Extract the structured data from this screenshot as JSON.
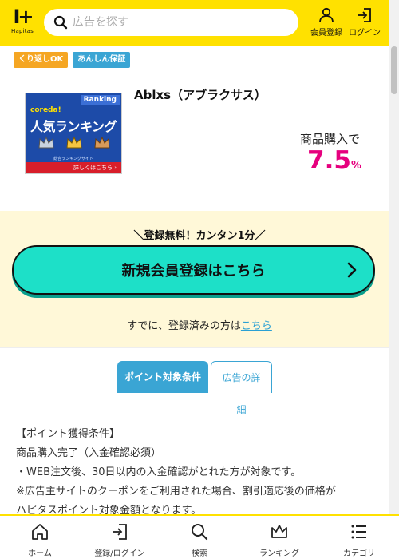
{
  "header": {
    "logo_text": "Hapitas",
    "search_placeholder": "広告を探す",
    "register_label": "会員登録",
    "login_label": "ログイン"
  },
  "tags": [
    "くり返しOK",
    "あんしん保証"
  ],
  "ad": {
    "name": "Ablxs（アブラクサス）",
    "banner": {
      "badge": "Ranking",
      "brand": "coreda!",
      "title": "人気ランキング",
      "sub": "総合ランキングサイト",
      "foot": "詳しくはこちら ›"
    },
    "reward_label": "商品購入で",
    "reward_value": "7.5",
    "reward_unit": "%"
  },
  "register": {
    "catch": "＼登録無料！カンタン1分／",
    "button_label": "新規会員登録はこちら",
    "login_prefix": "すでに、登録済みの方は",
    "login_link": "こちら"
  },
  "tabs": {
    "conditions": "ポイント対象条件",
    "details": "広告の詳細"
  },
  "conditions": {
    "line1": "【ポイント獲得条件】",
    "line2": "商品購入完了（入金確認必須）",
    "line3": "・WEB注文後、30日以内の入金確認がとれた方が対象です。",
    "line4": "※広告主サイトのクーポンをご利用された場合、割引適応後の価格が",
    "line5": "ハピタスポイント対象金額となります。"
  },
  "bottom_nav": [
    {
      "label": "ホーム",
      "icon": "home-icon"
    },
    {
      "label": "登録/ログイン",
      "icon": "login-icon"
    },
    {
      "label": "検索",
      "icon": "search-icon"
    },
    {
      "label": "ランキング",
      "icon": "crown-icon"
    },
    {
      "label": "カテゴリ",
      "icon": "list-icon"
    }
  ],
  "colors": {
    "brand_yellow": "#ffe100",
    "accent_pink": "#e6007e",
    "accent_blue": "#3aa5d4",
    "cta_teal": "#1de0c8"
  }
}
